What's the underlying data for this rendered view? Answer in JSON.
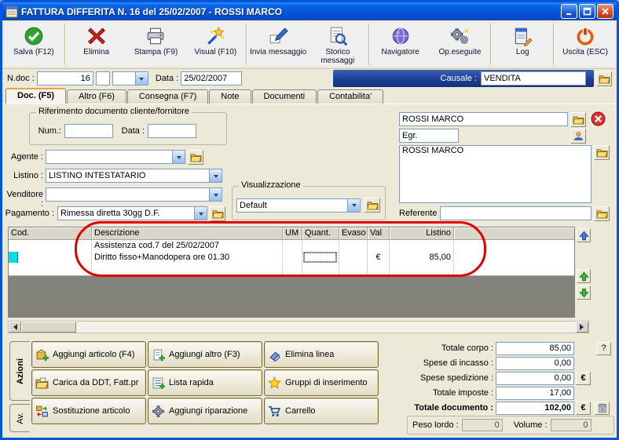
{
  "colors": {
    "titlebar_blue": "#0A63E8",
    "causale_navy": "#1E3F96",
    "annotation_red": "#E00000",
    "row_marker_cyan": "#00E0E0",
    "window_bg": "#ECE9D8"
  },
  "window": {
    "title": "FATTURA DIFFERITA N. 16  del 25/02/2007 - ROSSI MARCO"
  },
  "toolbar": {
    "buttons": [
      {
        "label": "Salva (F12)"
      },
      {
        "label": "Elimina"
      },
      {
        "label": "Stampa (F9)"
      },
      {
        "label": "Visual (F10)"
      },
      {
        "label": "Invia messaggio"
      },
      {
        "label": "Storico messaggi"
      },
      {
        "label": "Navigatore"
      },
      {
        "label": "Op.eseguite"
      },
      {
        "label": "Log"
      },
      {
        "label": "Uscita (ESC)"
      }
    ]
  },
  "doc_header": {
    "ndoc_label": "N.doc :",
    "ndoc_value": "16",
    "data_label": "Data :",
    "data_value": "25/02/2007",
    "causale_label": "Causale :",
    "causale_value": "VENDITA"
  },
  "tabs": [
    {
      "label": "Doc. (F5)"
    },
    {
      "label": "Altro (F6)"
    },
    {
      "label": "Consegna (F7)"
    },
    {
      "label": "Note"
    },
    {
      "label": "Documenti"
    },
    {
      "label": "Contabilita'"
    }
  ],
  "form": {
    "rif_group_title": "Riferimento documento cliente/fornitore",
    "num_label": "Num.:",
    "num_value": "",
    "rif_data_label": "Data :",
    "rif_data_value": "",
    "agente_label": "Agente :",
    "agente_value": "",
    "listino_label": "Listino :",
    "listino_value": "LISTINO INTESTATARIO",
    "venditore_label": "Venditore :",
    "venditore_value": "",
    "pagamento_label": "Pagamento :",
    "pagamento_value": "Rimessa diretta 30gg D.F.",
    "visualizzazione_group_title": "Visualizzazione",
    "visualizzazione_value": "Default",
    "cliente_value": "ROSSI MARCO",
    "egr_value": "Egr.",
    "indirizzo_value": "ROSSI MARCO",
    "referente_label": "Referente",
    "referente_value": ""
  },
  "table": {
    "headers": [
      "Cod.",
      "Descrizione",
      "UM",
      "Quant.",
      "Evaso",
      "Val",
      "Listino"
    ],
    "rows": [
      {
        "cod": "",
        "descrizione": "Assistenza cod.7 del 25/02/2007",
        "um": "",
        "quant": "",
        "evaso": "",
        "val": "",
        "listino": ""
      },
      {
        "cod": "",
        "descrizione": "Diritto fisso+Manodopera ore 01.30",
        "um": "",
        "quant": "",
        "evaso": "",
        "val": "€",
        "listino": "85,00"
      }
    ]
  },
  "actions": {
    "tab_azioni": "Azioni",
    "tab_av": "Av.",
    "buttons": [
      {
        "label": "Aggiungi articolo (F4)"
      },
      {
        "label": "Aggiungi altro (F3)"
      },
      {
        "label": "Elimina linea"
      },
      {
        "label": "Carica da DDT, Fatt.pr"
      },
      {
        "label": "Lista rapida"
      },
      {
        "label": "Gruppi di inserimento"
      },
      {
        "label": "Sostituzione articolo"
      },
      {
        "label": "Aggiungi riparazione"
      },
      {
        "label": "Carrello"
      }
    ]
  },
  "totals": {
    "rows": [
      {
        "label": "Totale corpo :",
        "value": "85,00"
      },
      {
        "label": "Spese di incasso :",
        "value": "0,00"
      },
      {
        "label": "Spese spedizione :",
        "value": "0,00"
      },
      {
        "label": "Totale imposte :",
        "value": "17,00"
      },
      {
        "label": "Totale documento :",
        "value": "102,00"
      }
    ],
    "help_label": "?",
    "euro_label": "€",
    "peso_label": "Peso lordo :",
    "peso_value": "0",
    "volume_label": "Volume :",
    "volume_value": "0"
  }
}
